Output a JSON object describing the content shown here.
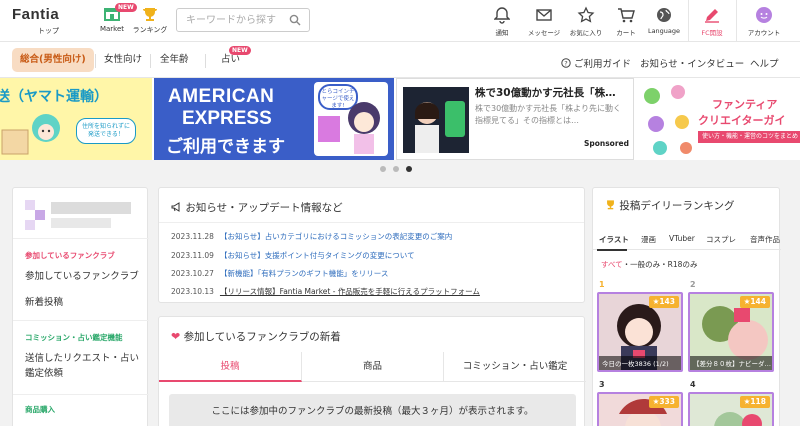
{
  "header": {
    "logo_text": "Fantia",
    "nav": [
      {
        "label": "トップ"
      },
      {
        "label": "Market",
        "badge": "NEW"
      },
      {
        "label": "ランキング"
      }
    ],
    "search_placeholder": "キーワードから探す",
    "right_nav": [
      {
        "label": "通知"
      },
      {
        "label": "メッセージ"
      },
      {
        "label": "お気に入り"
      },
      {
        "label": "カート"
      },
      {
        "label": "Language"
      },
      {
        "label": "FC開設"
      },
      {
        "label": "アカウント"
      }
    ]
  },
  "subnav": {
    "categories": [
      {
        "label": "総合(男性向け)"
      },
      {
        "label": "女性向け"
      },
      {
        "label": "全年齢"
      },
      {
        "label": "占い",
        "badge": "NEW"
      }
    ],
    "links": [
      "ご利用ガイド",
      "お知らせ・インタビュー",
      "ヘルプ"
    ]
  },
  "banners": {
    "b1_text": "送（ヤマト運輸）",
    "b1_sub": "住所を知られずに発送できる！",
    "b2_line1": "AMERICAN",
    "b2_line2": "EXPRESS",
    "b2_line3": "ご利用できます",
    "b2_badge": "とらコインチャージで使えます!",
    "b3_title": "株で30億動かす元社長「株…",
    "b3_desc": "株で30億動かす元社長「株より先に動く指標見てる」その指標とは…",
    "b3_sponsor": "Sponsored",
    "b4_line1": "ファンティア",
    "b4_line2": "クリエイターガイ",
    "b4_line3": "使い方・機能・運営のコツをまとめ"
  },
  "left_sidebar": {
    "section1_title": "参加しているファンクラブ",
    "section1_items": [
      "参加しているファンクラブ",
      "新着投稿"
    ],
    "section2_title": "コミッション・占い鑑定機能",
    "section2_items": [
      "送信したリクエスト・占い鑑定依頼"
    ],
    "section3_title": "商品購入"
  },
  "news": {
    "title": "お知らせ・アップデート情報など",
    "items": [
      {
        "date": "2023.11.28",
        "text": "【お知らせ】占いカテゴリにおけるコミッションの表記変更のご案内"
      },
      {
        "date": "2023.11.09",
        "text": "【お知らせ】支援ポイント付与タイミングの変更について"
      },
      {
        "date": "2023.10.27",
        "text": "【新機能】「有料プランのギフト機能」をリリース"
      },
      {
        "date": "2023.10.13",
        "text": "【リリース情報】Fantia Market - 作品販売を手軽に行えるプラットフォーム"
      }
    ]
  },
  "fan_feed": {
    "title": "参加しているファンクラブの新着",
    "tabs": [
      "投稿",
      "商品",
      "コミッション・占い鑑定"
    ],
    "empty_message": "ここには参加中のファンクラブの最新投稿（最大３ヶ月）が表示されます。"
  },
  "ranking": {
    "title": "投稿デイリーランキング",
    "tabs": [
      "イラスト",
      "漫画",
      "VTuber",
      "コスプレ",
      "音声作品"
    ],
    "filter_all": "すべて",
    "filter_rest": "・一般のみ・R18のみ",
    "items": [
      {
        "rank": "1",
        "stars": "143",
        "caption": "今日の一枚3836 (1/2)"
      },
      {
        "rank": "2",
        "stars": "144",
        "caption": "【差分８０枚】ナビーダ…"
      },
      {
        "rank": "3",
        "stars": "333",
        "caption": ""
      },
      {
        "rank": "4",
        "stars": "118",
        "caption": ""
      }
    ]
  },
  "colors": {
    "accent": "#e8496f",
    "rank_border": "#b681e0",
    "star": "#f6b230",
    "link": "#2f6dbd"
  }
}
